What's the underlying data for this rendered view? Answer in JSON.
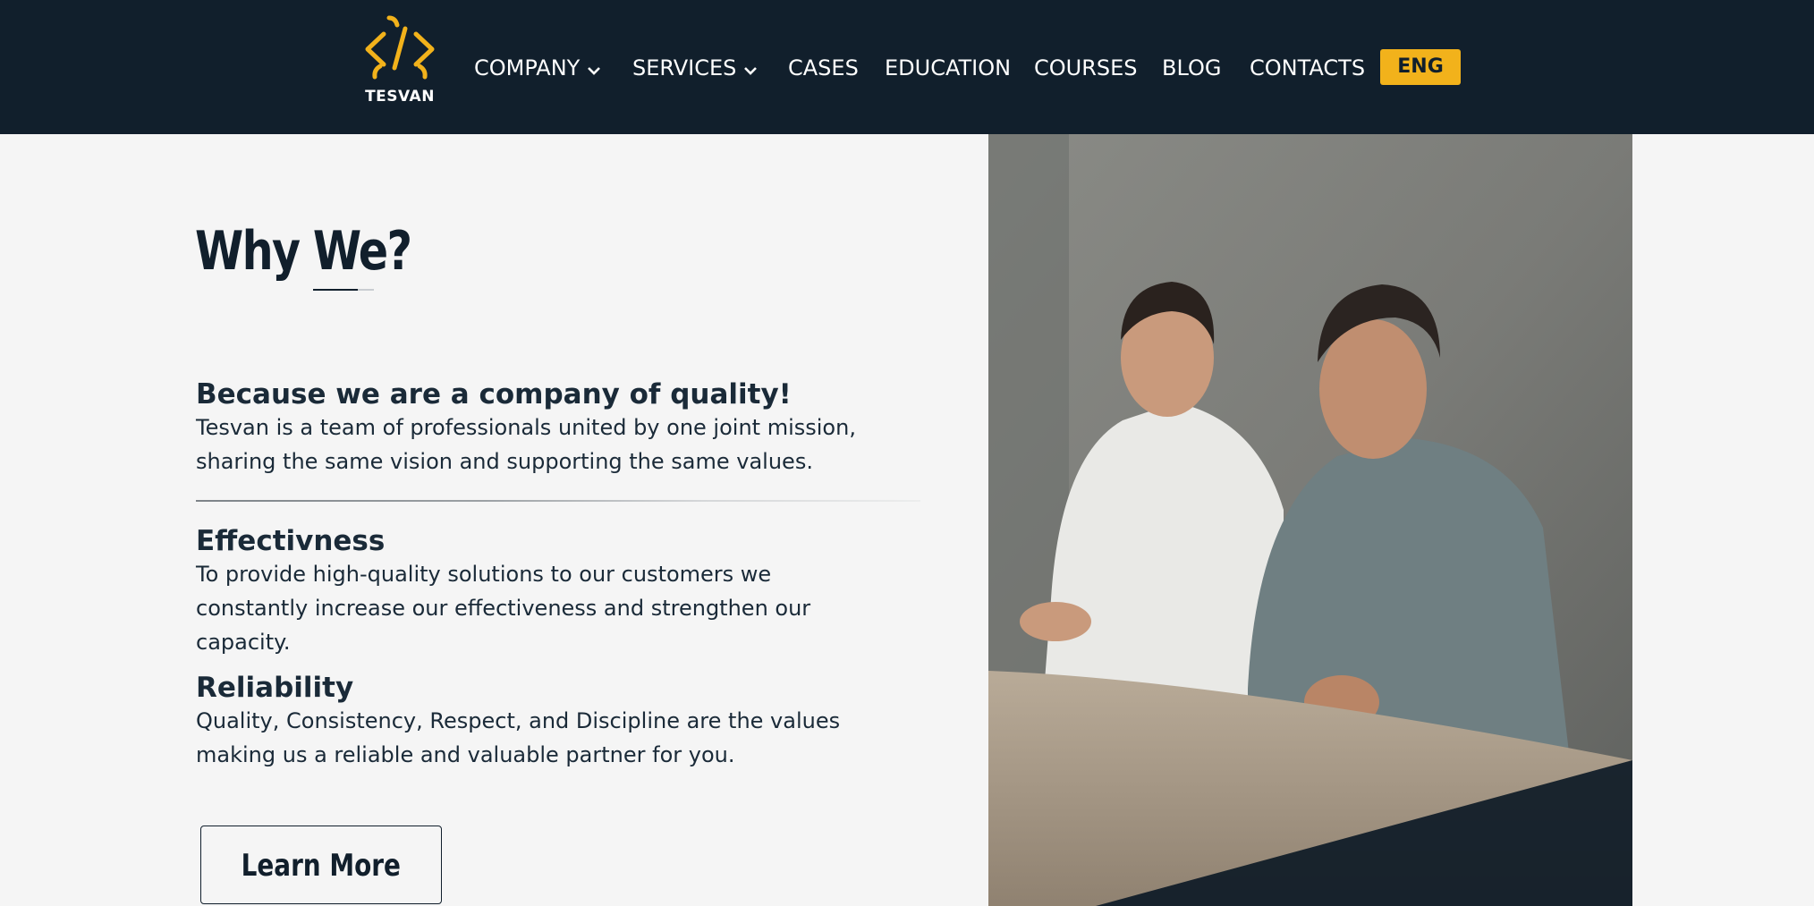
{
  "brand": {
    "name": "TESVAN",
    "accent_color": "#f2b21b",
    "header_color": "#111f2c"
  },
  "nav": {
    "items": [
      {
        "label": "COMPANY",
        "has_dropdown": true
      },
      {
        "label": "SERVICES",
        "has_dropdown": true
      },
      {
        "label": "CASES",
        "has_dropdown": false
      },
      {
        "label": "EDUCATION",
        "has_dropdown": false
      },
      {
        "label": "COURSES",
        "has_dropdown": false
      },
      {
        "label": "BLOG",
        "has_dropdown": false
      },
      {
        "label": "CONTACTS",
        "has_dropdown": false
      }
    ],
    "language": "ENG"
  },
  "main": {
    "title": "Why We?",
    "sections": [
      {
        "heading": "Because we are a company of quality!",
        "text": "Tesvan is a team of professionals united by one joint mission, sharing the same vision and supporting the same values."
      },
      {
        "heading": "Effectivness",
        "text": "To provide high-quality solutions to our customers we constantly increase our effectiveness and strengthen our capacity."
      },
      {
        "heading": "Reliability",
        "text": "Quality, Consistency, Respect, and Discipline are the values making us a reliable and valuable partner for you."
      }
    ],
    "cta_label": "Learn More"
  }
}
